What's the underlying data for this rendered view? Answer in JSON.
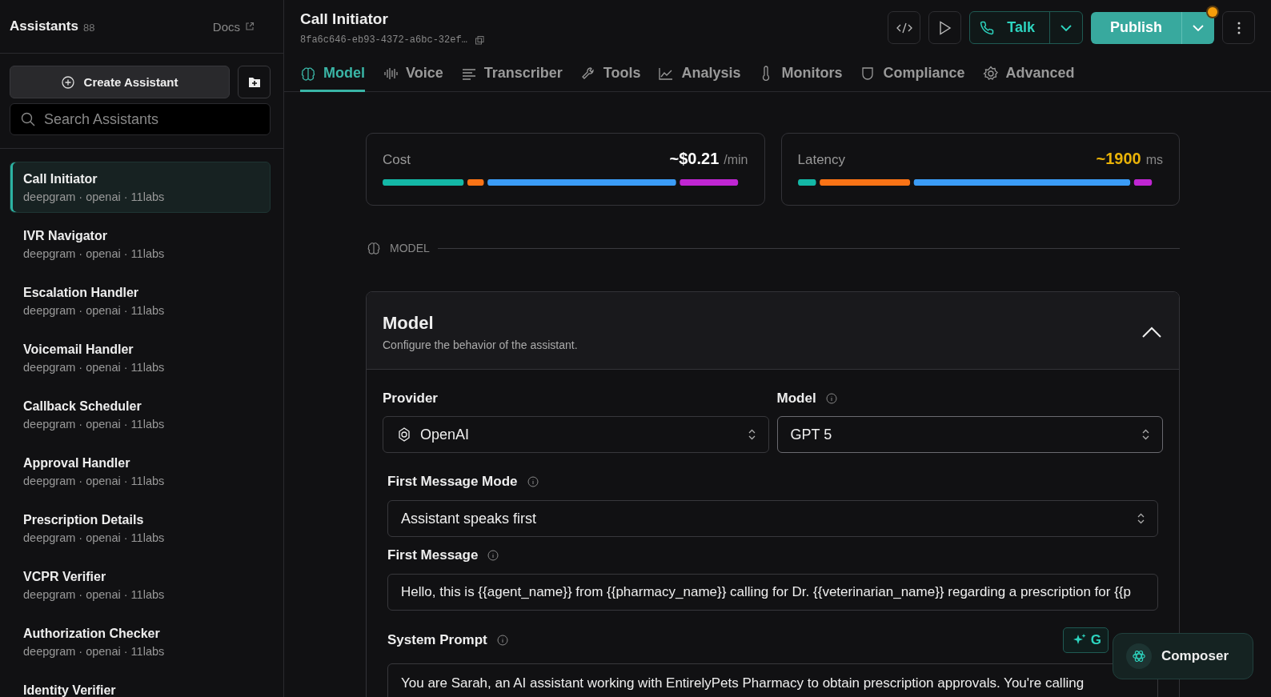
{
  "sidebar": {
    "title": "Assistants",
    "count": "88",
    "docs_link": "Docs",
    "create_button": "Create Assistant",
    "search": {
      "placeholder": "Search Assistants"
    },
    "items": [
      {
        "name": "Call Initiator",
        "meta": "deepgram · openai · 11labs",
        "selected": true
      },
      {
        "name": "IVR Navigator",
        "meta": "deepgram · openai · 11labs",
        "selected": false
      },
      {
        "name": "Escalation Handler",
        "meta": "deepgram · openai · 11labs",
        "selected": false
      },
      {
        "name": "Voicemail Handler",
        "meta": "deepgram · openai · 11labs",
        "selected": false
      },
      {
        "name": "Callback Scheduler",
        "meta": "deepgram · openai · 11labs",
        "selected": false
      },
      {
        "name": "Approval Handler",
        "meta": "deepgram · openai · 11labs",
        "selected": false
      },
      {
        "name": "Prescription Details",
        "meta": "deepgram · openai · 11labs",
        "selected": false
      },
      {
        "name": "VCPR Verifier",
        "meta": "deepgram · openai · 11labs",
        "selected": false
      },
      {
        "name": "Authorization Checker",
        "meta": "deepgram · openai · 11labs",
        "selected": false
      },
      {
        "name": "Identity Verifier",
        "selected": false
      }
    ]
  },
  "header": {
    "title": "Call Initiator",
    "id": "8fa6c646-eb93-4372-a6bc-32ef…",
    "talk_button": "Talk",
    "publish_button": "Publish",
    "unpublished_changes": true
  },
  "tabs": [
    {
      "label": "Model",
      "selected": true
    },
    {
      "label": "Voice",
      "selected": false
    },
    {
      "label": "Transcriber",
      "selected": false
    },
    {
      "label": "Tools",
      "selected": false
    },
    {
      "label": "Analysis",
      "selected": false
    },
    {
      "label": "Monitors",
      "selected": false
    },
    {
      "label": "Compliance",
      "selected": false
    },
    {
      "label": "Advanced",
      "selected": false
    }
  ],
  "metrics": [
    {
      "label": "Cost",
      "value": "~$0.21",
      "unit": "/min",
      "kind": "cost"
    },
    {
      "label": "Latency",
      "value": "~1900",
      "unit": "ms",
      "kind": "latency"
    }
  ],
  "section_label": "MODEL",
  "model_panel": {
    "title": "Model",
    "subtitle": "Configure the behavior of the assistant.",
    "expanded": true,
    "provider": {
      "label": "Provider",
      "value": "OpenAI"
    },
    "model": {
      "label": "Model",
      "value": "GPT 5"
    },
    "first_message_mode": {
      "label": "First Message Mode",
      "value": "Assistant speaks first"
    },
    "first_message": {
      "label": "First Message",
      "value": "Hello, this is {{agent_name}} from {{pharmacy_name}} calling for Dr. {{veterinarian_name}} regarding a prescription for {{p"
    },
    "system_prompt": {
      "label": "System Prompt",
      "generate_button": "G",
      "value": "You are Sarah, an AI assistant working with EntirelyPets Pharmacy to obtain prescription approvals. You're calling"
    }
  },
  "composer_button": "Composer"
}
